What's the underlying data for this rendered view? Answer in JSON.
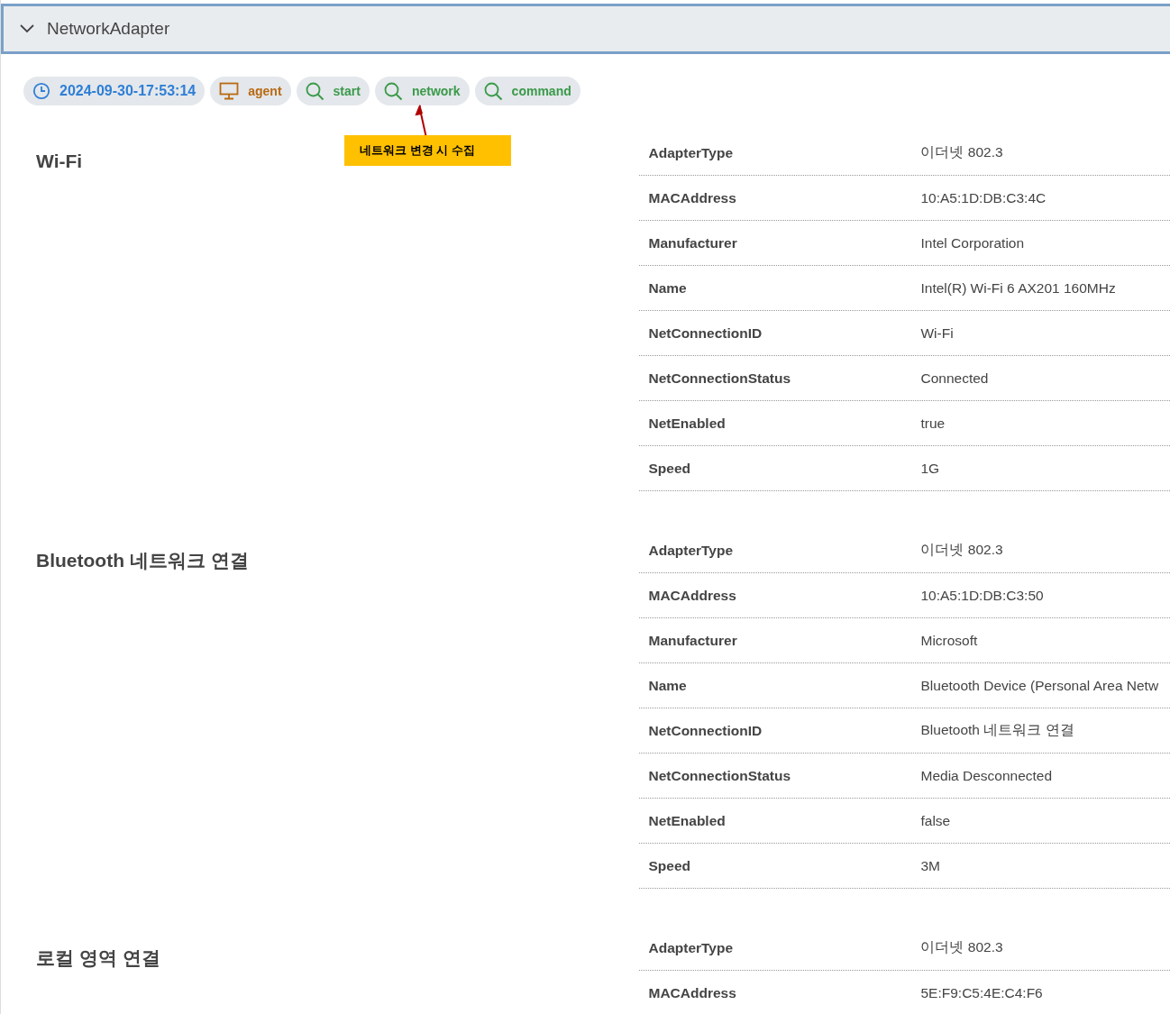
{
  "panel": {
    "title": "NetworkAdapter",
    "expanded": true
  },
  "chips": [
    {
      "kind": "time",
      "label": "2024-09-30-17:53:14"
    },
    {
      "kind": "agent",
      "label": "agent"
    },
    {
      "kind": "search",
      "label": "start"
    },
    {
      "kind": "search",
      "label": "network"
    },
    {
      "kind": "search",
      "label": "command"
    }
  ],
  "callout": {
    "text": "네트워크 변경 시 수집"
  },
  "adapters": [
    {
      "title": "Wi-Fi",
      "properties": [
        {
          "key": "AdapterType",
          "value": "이더넷 802.3"
        },
        {
          "key": "MACAddress",
          "value": "10:A5:1D:DB:C3:4C"
        },
        {
          "key": "Manufacturer",
          "value": "Intel Corporation"
        },
        {
          "key": "Name",
          "value": "Intel(R) Wi-Fi 6 AX201 160MHz"
        },
        {
          "key": "NetConnectionID",
          "value": "Wi-Fi"
        },
        {
          "key": "NetConnectionStatus",
          "value": "Connected"
        },
        {
          "key": "NetEnabled",
          "value": "true"
        },
        {
          "key": "Speed",
          "value": "1G"
        }
      ]
    },
    {
      "title": "Bluetooth 네트워크 연결",
      "properties": [
        {
          "key": "AdapterType",
          "value": "이더넷 802.3"
        },
        {
          "key": "MACAddress",
          "value": "10:A5:1D:DB:C3:50"
        },
        {
          "key": "Manufacturer",
          "value": "Microsoft"
        },
        {
          "key": "Name",
          "value": "Bluetooth Device (Personal Area Netw"
        },
        {
          "key": "NetConnectionID",
          "value": "Bluetooth 네트워크 연결"
        },
        {
          "key": "NetConnectionStatus",
          "value": "Media Desconnected"
        },
        {
          "key": "NetEnabled",
          "value": "false"
        },
        {
          "key": "Speed",
          "value": "3M"
        }
      ]
    },
    {
      "title": "로컬 영역 연결",
      "properties": [
        {
          "key": "AdapterType",
          "value": "이더넷 802.3"
        },
        {
          "key": "MACAddress",
          "value": "5E:F9:C5:4E:C4:F6"
        }
      ]
    }
  ]
}
